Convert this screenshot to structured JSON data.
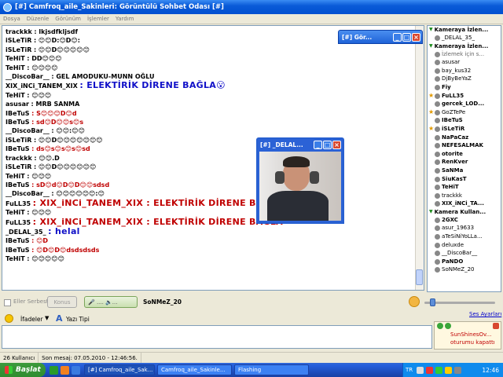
{
  "window": {
    "title": "[#] Camfroq_aile_Sakinleri: Görüntülü Sohbet Odası [#]"
  },
  "menu": [
    "Dosya",
    "Düzenle",
    "Görünüm",
    "İşlemler",
    "Yardım"
  ],
  "chat": {
    "messages": [
      {
        "nick": "trackkk",
        "text": ": lkjsdfkljsdf",
        "color": "#000000",
        "emoji": 0
      },
      {
        "nick": "iSLeTiR",
        "text": ": 😊😊D:😊D😊:",
        "color": "#000000",
        "emoji": 0
      },
      {
        "nick": "iSLeTiR",
        "text": ": 😊😊D😊😊😊😊😊",
        "color": "#000000",
        "emoji": 0
      },
      {
        "nick": "TeHiT",
        "text": ": DD😊😊😊",
        "color": "#000000",
        "emoji": 0
      },
      {
        "nick": "TeHiT",
        "text": ": 😊😊😊😊",
        "color": "#000000",
        "emoji": 0
      },
      {
        "nick": "__DiscoBar__",
        "text": ": GEL AMODUKU-MUNN OĞLU",
        "color": "#000000",
        "emoji": 0
      },
      {
        "nick": "XIX_iNCi_TANEM_XIX",
        "text": ": ELEKTİRİK DİRENE BAĞLA😮",
        "color": "#1010c8",
        "emoji": 0,
        "big": true
      },
      {
        "nick": "TeHiT",
        "text": ": 😊😊😊",
        "color": "#000000",
        "emoji": 0
      },
      {
        "nick": "asusar",
        "text": ": MRB SANMA",
        "color": "#000000",
        "emoji": 0
      },
      {
        "nick": "IBeTuS",
        "text": ": S😊😊😊D😊d",
        "color": "#c00000",
        "emoji": 0
      },
      {
        "nick": "IBeTuS",
        "text": ": sd😊D😊😊s😊s",
        "color": "#c00000",
        "emoji": 0
      },
      {
        "nick": "__DiscoBar__",
        "text": ": 😊😊:😊😊",
        "color": "#000000",
        "emoji": 0
      },
      {
        "nick": "iSLeTiR",
        "text": ": 😊😊D😊😊😊😊😊😊😊",
        "color": "#000000",
        "emoji": 0
      },
      {
        "nick": "IBeTuS",
        "text": ": ds😊s😊s😊s😊sd",
        "color": "#c00000",
        "emoji": 0
      },
      {
        "nick": "trackkk",
        "text": ": 😊😊.D",
        "color": "#000000",
        "emoji": 0
      },
      {
        "nick": "iSLeTiR",
        "text": ": 😊😊D😊😊😊😊😊😊",
        "color": "#000000",
        "emoji": 0
      },
      {
        "nick": "TeHiT",
        "text": ": 😊😊😊",
        "color": "#000000",
        "emoji": 0
      },
      {
        "nick": "IBeTuS",
        "text": ": sD😊d😊D😊D😊😊sdsd",
        "color": "#c00000",
        "emoji": 0
      },
      {
        "nick": "__DiscoBar__",
        "text": ": 😊😊😊😊😊😊:😊",
        "color": "#000000",
        "emoji": 0
      },
      {
        "nick": "FuLL35",
        "text": ": XIX_iNCi_TANEM_XIX : ELEKTİRİK DİRENE BAĞLA",
        "color": "#c00000",
        "emoji": 0,
        "big": true
      },
      {
        "nick": "TeHiT",
        "text": ": 😊😊😊",
        "color": "#000000",
        "emoji": 0
      },
      {
        "nick": "FuLL35",
        "text": ": XIX_iNCi_TANEM_XIX : ELEKTİRİK DİRENE BAĞLA",
        "color": "#c00000",
        "emoji": 0,
        "big": true
      },
      {
        "nick": "_DELAL_35_",
        "text": ": helal",
        "color": "#1010c8",
        "emoji": 0,
        "big": true
      },
      {
        "nick": "IBeTuS",
        "text": ": 😊D",
        "color": "#c00000",
        "emoji": 0
      },
      {
        "nick": "IBeTuS",
        "text": ": 😊D😊D😊dsdsdsds",
        "color": "#c00000",
        "emoji": 0
      },
      {
        "nick": "TeHiT",
        "text": ": 😊😊😊😊😊",
        "color": "#000000",
        "emoji": 0
      }
    ]
  },
  "webcam_small": {
    "title": "[#] Gör..."
  },
  "webcam_large": {
    "title": "[#] _DELAL..."
  },
  "sidebar": {
    "group1_title": "Kameraya İzlen...",
    "group1": [
      {
        "name": "_DELAL_35_",
        "style": ""
      }
    ],
    "group2_title": "Kameraya İzlen...",
    "group2": [
      {
        "name": "İzlemek için s...",
        "style": "dim"
      },
      {
        "name": "asusar",
        "style": ""
      },
      {
        "name": "bay_kus32",
        "style": ""
      },
      {
        "name": "DjByBeYaZ",
        "style": ""
      },
      {
        "name": "Fiy",
        "style": "bold"
      },
      {
        "name": "FuLL35",
        "style": "bold",
        "star": true
      },
      {
        "name": "gercek_LOD...",
        "style": "bold"
      },
      {
        "name": "GoZTePe",
        "style": "",
        "star": true
      },
      {
        "name": "IBeTuS",
        "style": "bold"
      },
      {
        "name": "iSLeTiR",
        "style": "bold",
        "star": true
      },
      {
        "name": "NaPaCaz",
        "style": "bold"
      },
      {
        "name": "NEFESALMAK",
        "style": "bold"
      },
      {
        "name": "otorite",
        "style": "bold"
      },
      {
        "name": "RenKver",
        "style": "bold"
      },
      {
        "name": "SaNMa",
        "style": "bold"
      },
      {
        "name": "SiuKasT",
        "style": "bold"
      },
      {
        "name": "TeHiT",
        "style": "bold"
      },
      {
        "name": "trackkk",
        "style": ""
      },
      {
        "name": "XIX_iNCi_TA...",
        "style": "bold"
      }
    ],
    "group3_title": "Kamera Kullan...",
    "group3": [
      {
        "name": "2GXC",
        "style": "bold"
      },
      {
        "name": "asur_19633",
        "style": ""
      },
      {
        "name": "aTeSiNiYoLLa...",
        "style": ""
      },
      {
        "name": "deluxde",
        "style": ""
      },
      {
        "name": "__DiscoBar__",
        "style": ""
      },
      {
        "name": "PaNDO",
        "style": "bold"
      },
      {
        "name": "SoNMeZ_20",
        "style": ""
      }
    ]
  },
  "controls": {
    "eller_serbest": "Eller Serbest",
    "konus": "Konus",
    "mic_label": "🎤 ....  🔈...",
    "speaker": "SoNMeZ_20",
    "ses_ayarlari": "Ses Ayarları",
    "ifadeler": "İfadeler",
    "dropdown": "▼",
    "yazi_tipi": "Yazı Tipi",
    "font_glyph": "A"
  },
  "status": {
    "users": "26 Kullanıcı",
    "last_msg": "Son mesaj: 07.05.2010 - 12:46:56."
  },
  "toast": {
    "name": "SunShinesOv...",
    "text": "oturumu kapattı"
  },
  "taskbar": {
    "start": "Başlat",
    "tasks": [
      "[#] Camfroq_aile_Sak...",
      "Camfroq_aile_Sakinle...",
      "Flashing"
    ],
    "lang": "TR",
    "clock": "12:46"
  }
}
